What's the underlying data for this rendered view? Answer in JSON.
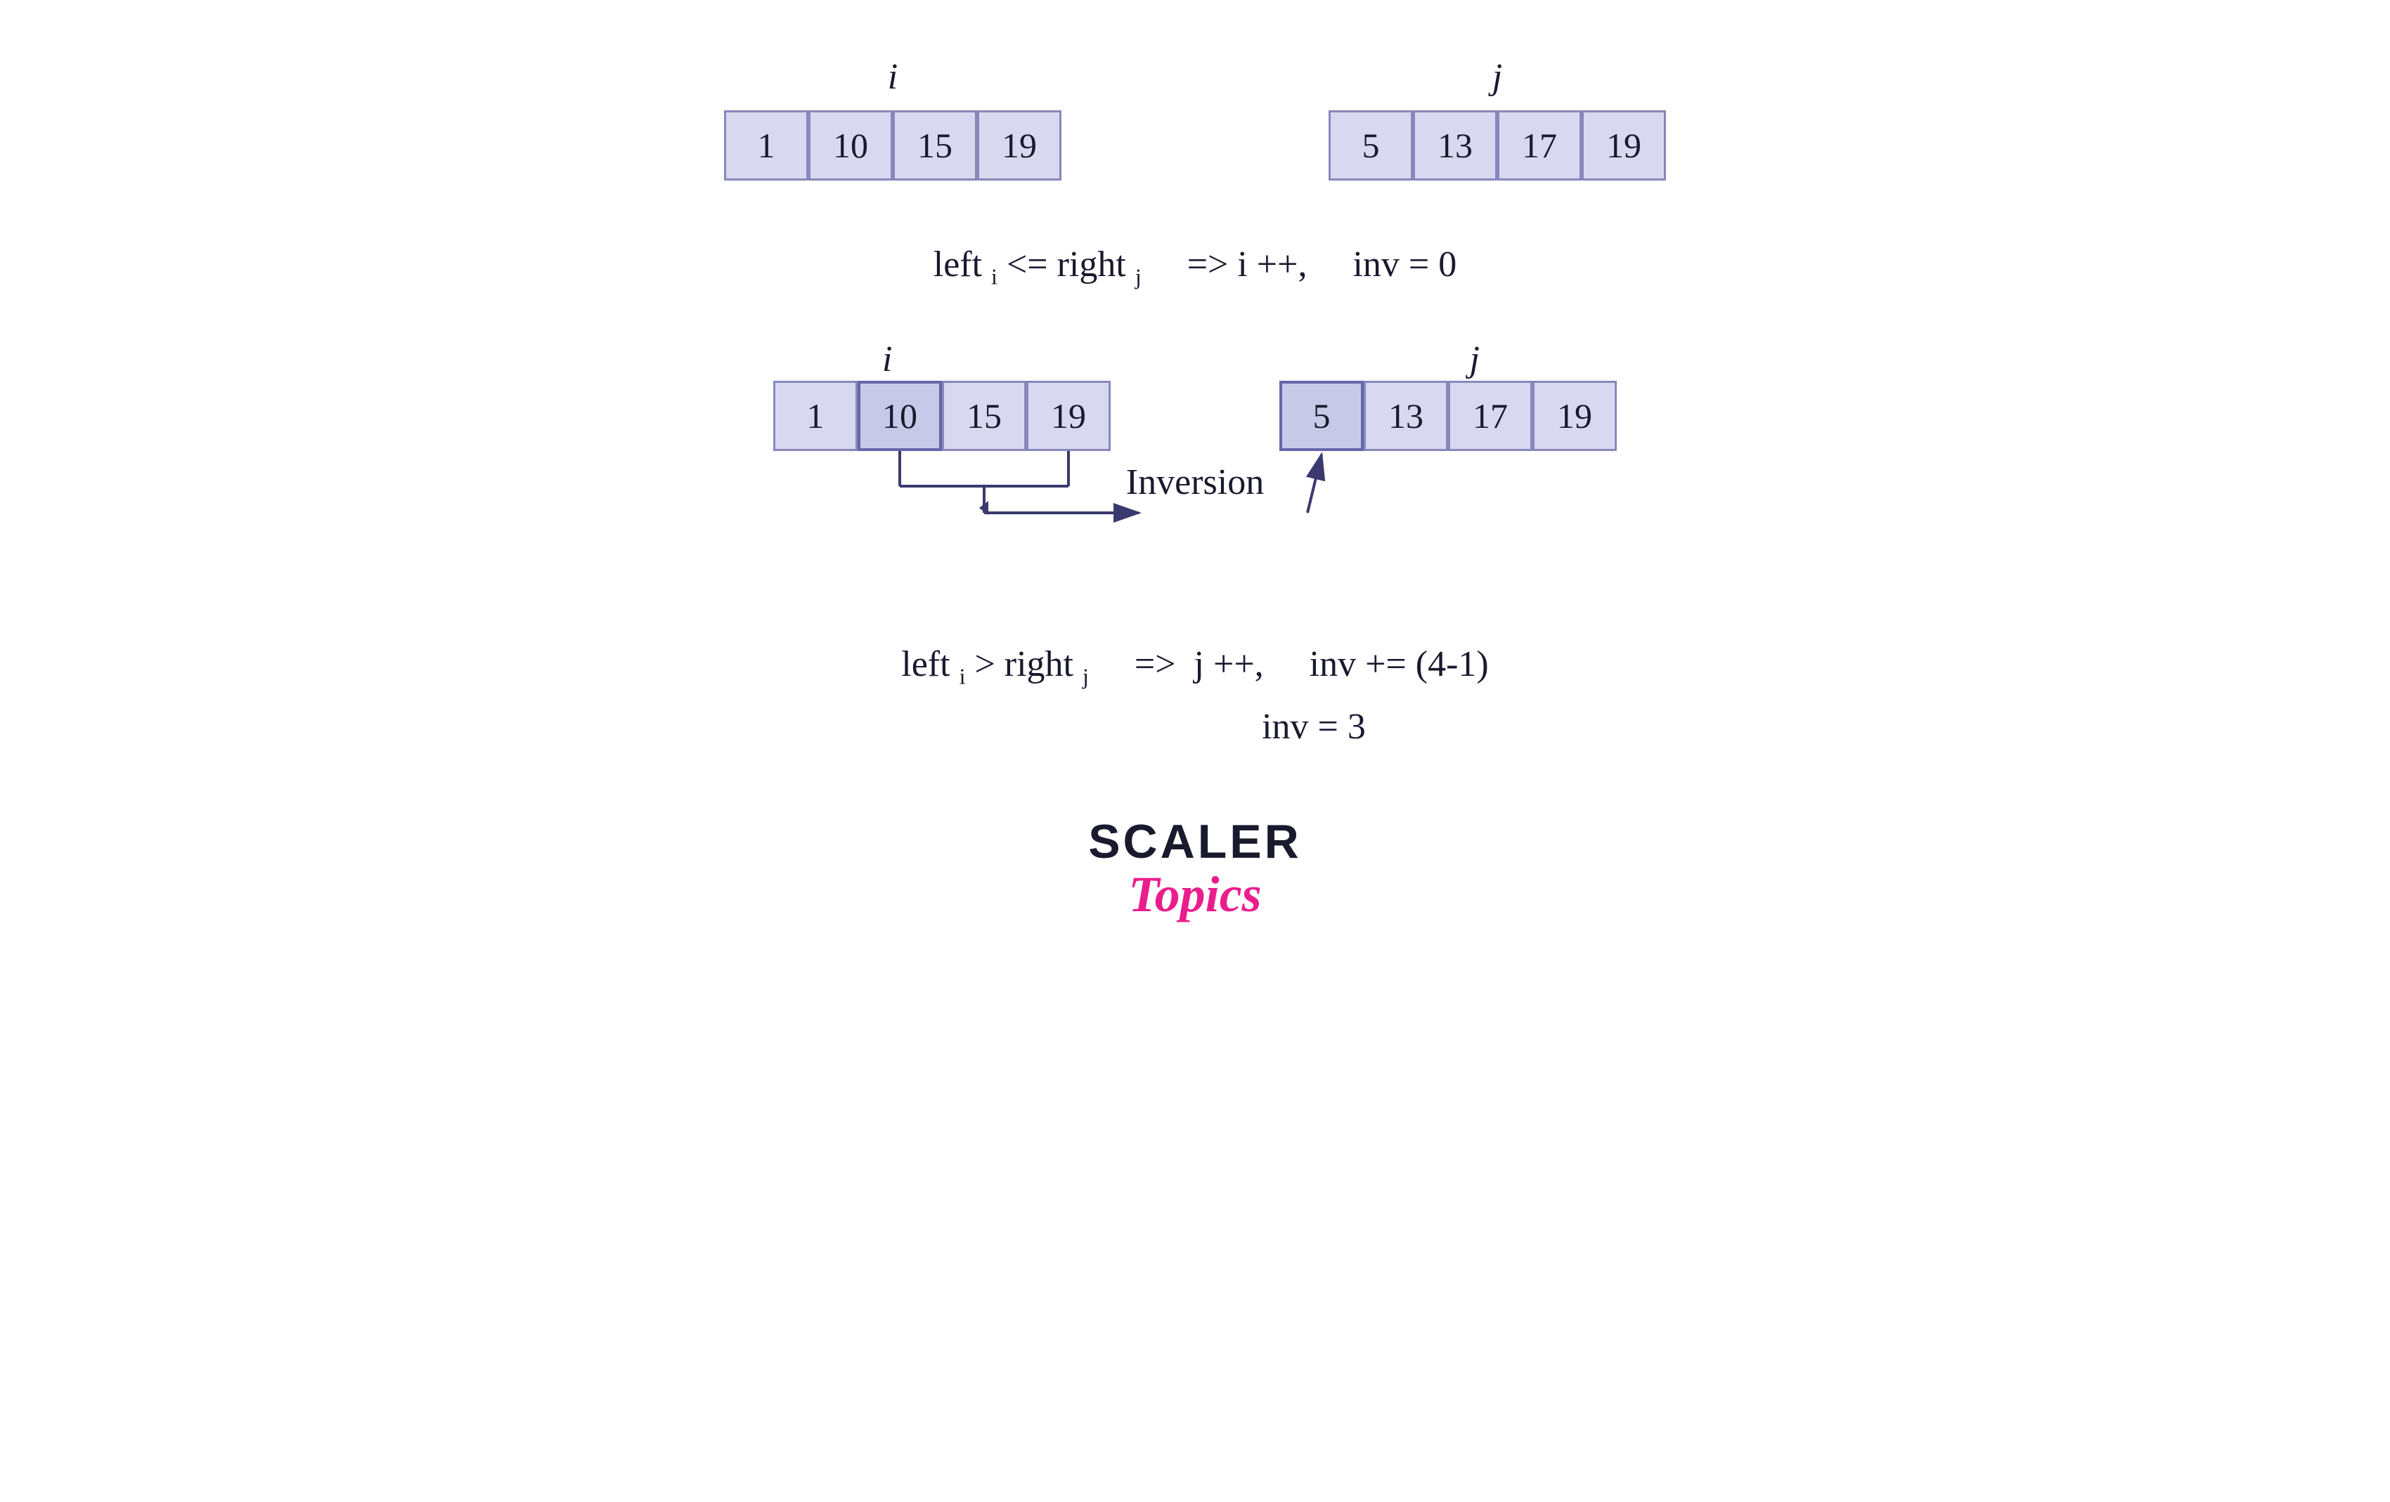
{
  "diagram": {
    "top_section": {
      "left_array": {
        "label": "i",
        "values": [
          1,
          10,
          15,
          19
        ]
      },
      "right_array": {
        "label": "j",
        "values": [
          5,
          13,
          17,
          19
        ]
      }
    },
    "condition_1": {
      "text": "left",
      "i_sub": "i",
      "operator": " <= right",
      "j_sub": "j",
      "arrow": "  =>  i ++,",
      "result": "    inv = 0"
    },
    "bottom_section": {
      "left_array": {
        "label": "i",
        "values": [
          1,
          10,
          15,
          19
        ],
        "highlighted_index": 1
      },
      "right_array": {
        "label": "j",
        "values": [
          5,
          13,
          17,
          19
        ],
        "highlighted_index": 0
      },
      "inversion_label": "Inversion"
    },
    "condition_2": {
      "line1": "leftᴵ > rightⱼ   =>  j ++,    inv += (4-1)",
      "line2": "inv = 3",
      "text": "left",
      "i_sub": "i",
      "operator": " > right",
      "j_sub": "j",
      "arrow": "  =>  j ++,",
      "result": "    inv += (4-1)",
      "result2": "inv = 3"
    }
  },
  "logo": {
    "scaler": "SCALER",
    "topics": "Topics"
  }
}
